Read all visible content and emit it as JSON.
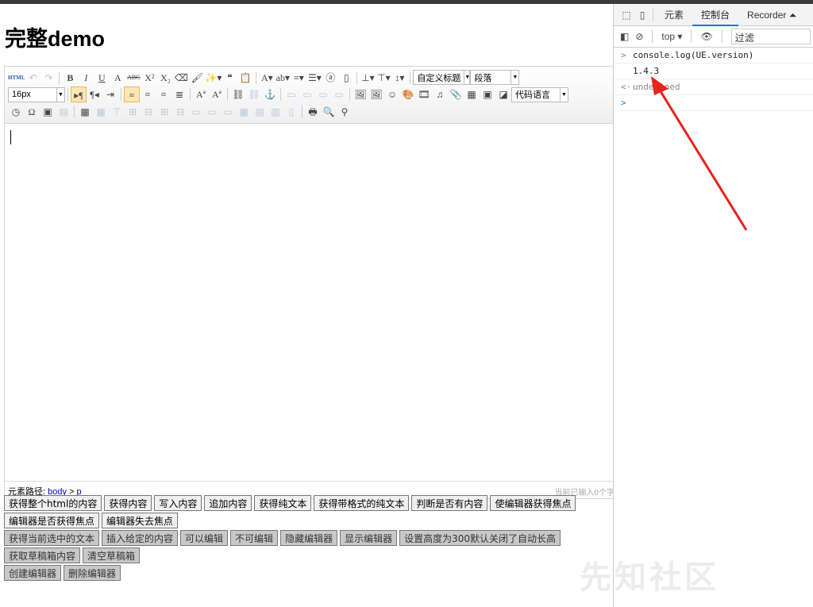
{
  "page": {
    "title": "完整demo"
  },
  "toolbar": {
    "row1": [
      [
        "html-icon",
        "HTML"
      ],
      [
        "undo-icon",
        "↶",
        1
      ],
      [
        "redo-icon",
        "↷",
        1
      ],
      [
        "|"
      ],
      [
        "bold-icon",
        "B"
      ],
      [
        "italic-icon",
        "I"
      ],
      [
        "underline-icon",
        "U"
      ],
      [
        "fontborder-icon",
        "A"
      ],
      [
        "strikethrough-icon",
        "ABC"
      ],
      [
        "superscript-icon",
        "X²"
      ],
      [
        "subscript-icon",
        "X₂"
      ],
      [
        "removeformat-icon",
        "⌫"
      ],
      [
        "formatmatch-icon",
        "🖌"
      ],
      [
        "autotypeset-icon",
        "✨▾"
      ],
      [
        "blockquote-icon",
        "❝"
      ],
      [
        "pasteplain-icon",
        "📋"
      ],
      [
        "|"
      ],
      [
        "forecolor-icon",
        "A▾"
      ],
      [
        "backcolor-icon",
        "ab▾"
      ],
      [
        "orderedlist-icon",
        "≡▾"
      ],
      [
        "unorderedlist-icon",
        "☰▾"
      ],
      [
        "selectall-icon",
        "ⓐ"
      ],
      [
        "cleardoc-icon",
        "▯"
      ],
      [
        "|"
      ],
      [
        "rowspacingtop-icon",
        "⊥▾"
      ],
      [
        "rowspacingbottom-icon",
        "⊤▾"
      ],
      [
        "lineheight-icon",
        "↕▾"
      ],
      [
        "|"
      ]
    ],
    "row2": [
      [
        "|"
      ],
      [
        "ltr-icon",
        "▸¶",
        0,
        1
      ],
      [
        "rtl-icon",
        "¶◂"
      ],
      [
        "indent-icon",
        "⇥"
      ],
      [
        "|"
      ],
      [
        "justifyleft-icon",
        "≡",
        0,
        1
      ],
      [
        "justifycenter-icon",
        "≡"
      ],
      [
        "justifyright-icon",
        "≡"
      ],
      [
        "justifyjustify-icon",
        "≣"
      ],
      [
        "|"
      ],
      [
        "touppercase-icon",
        "Aª"
      ],
      [
        "tolowercase-icon",
        "Aª"
      ],
      [
        "|"
      ],
      [
        "link-icon",
        "⛓"
      ],
      [
        "unlink-icon",
        "⛓",
        1
      ],
      [
        "anchor-icon",
        "⚓"
      ],
      [
        "|"
      ],
      [
        "imagenone-icon",
        "▭",
        1
      ],
      [
        "imageleft-icon",
        "▭",
        1
      ],
      [
        "imageright-icon",
        "▭",
        1
      ],
      [
        "imagecenter-icon",
        "▭",
        1
      ],
      [
        "|"
      ],
      [
        "simpleupload-icon",
        "🖼"
      ],
      [
        "insertimage-icon",
        "🖼"
      ],
      [
        "emotion-icon",
        "☺"
      ],
      [
        "scrawl-icon",
        "🎨"
      ],
      [
        "insertvideo-icon",
        "🎞"
      ],
      [
        "music-icon",
        "♫"
      ],
      [
        "attachment-icon",
        "📎"
      ],
      [
        "map-icon",
        "▦"
      ],
      [
        "gmap-icon",
        "▣"
      ],
      [
        "insertframe-icon",
        "◪"
      ]
    ],
    "row3": [
      [
        "time-icon",
        "◷"
      ],
      [
        "spechars-icon",
        "Ω"
      ],
      [
        "wordimage-icon",
        "▣"
      ],
      [
        "template-icon",
        "▤",
        1
      ],
      [
        "|"
      ],
      [
        "inserttable-icon",
        "▦"
      ],
      [
        "deletetable-icon",
        "▦",
        1
      ],
      [
        "paragraphbeforetable-icon",
        "⊤",
        1
      ],
      [
        "insertrow-icon",
        "⊞",
        1
      ],
      [
        "deleterow-icon",
        "⊟",
        1
      ],
      [
        "insertcol-icon",
        "⊞",
        1
      ],
      [
        "deletecol-icon",
        "⊟",
        1
      ],
      [
        "mergecells-icon",
        "▭",
        1
      ],
      [
        "mergeright-icon",
        "▭",
        1
      ],
      [
        "mergedown-icon",
        "▭",
        1
      ],
      [
        "splittocells-icon",
        "▦",
        1
      ],
      [
        "splittorows-icon",
        "▤",
        1
      ],
      [
        "splittocols-icon",
        "▥",
        1
      ],
      [
        "charts-icon",
        "▯",
        1
      ],
      [
        "|"
      ],
      [
        "print-icon",
        "🖶"
      ],
      [
        "preview-icon",
        "🔍"
      ],
      [
        "searchreplace-icon",
        "⚲"
      ]
    ],
    "customstyle": "自定义标题",
    "paragraph": "段落",
    "fontsize": "16px",
    "codelang": "代码语言"
  },
  "status": {
    "path_label": "元素路径:",
    "path": [
      "body",
      "p"
    ],
    "sep": ">",
    "count": "当前已输入0个字"
  },
  "buttons": [
    {
      "gray": false,
      "items": [
        "获得整个html的内容",
        "获得内容",
        "写入内容",
        "追加内容",
        "获得纯文本",
        "获得带格式的纯文本",
        "判断是否有内容",
        "使编辑器获得焦点"
      ]
    },
    {
      "gray": false,
      "items": [
        "编辑器是否获得焦点",
        "编辑器失去焦点"
      ]
    },
    {
      "gray": true,
      "items": [
        "获得当前选中的文本",
        "插入给定的内容",
        "可以编辑",
        "不可编辑",
        "隐藏编辑器",
        "显示编辑器",
        "设置高度为300默认关闭了自动长高"
      ]
    },
    {
      "gray": true,
      "items": [
        "获取草稿箱内容",
        "清空草稿箱"
      ]
    },
    {
      "gray": true,
      "items": [
        "创建编辑器",
        "删除编辑器"
      ]
    }
  ],
  "devtools": {
    "tabs": [
      "元素",
      "控制台",
      "Recorder ⏶"
    ],
    "active_tab": 1,
    "context": "top",
    "filter_placeholder": "过滤",
    "console": [
      {
        "prompt": ">",
        "text": "console.log(UE.version)",
        "style": ""
      },
      {
        "prompt": "",
        "text": "1.4.3",
        "style": ""
      },
      {
        "prompt": "<·",
        "text": "undefined",
        "style": "gray"
      },
      {
        "prompt": ">",
        "text": "",
        "style": "blue"
      }
    ]
  },
  "annotation": {
    "color": "#e8231b"
  },
  "watermark": "先知社区"
}
